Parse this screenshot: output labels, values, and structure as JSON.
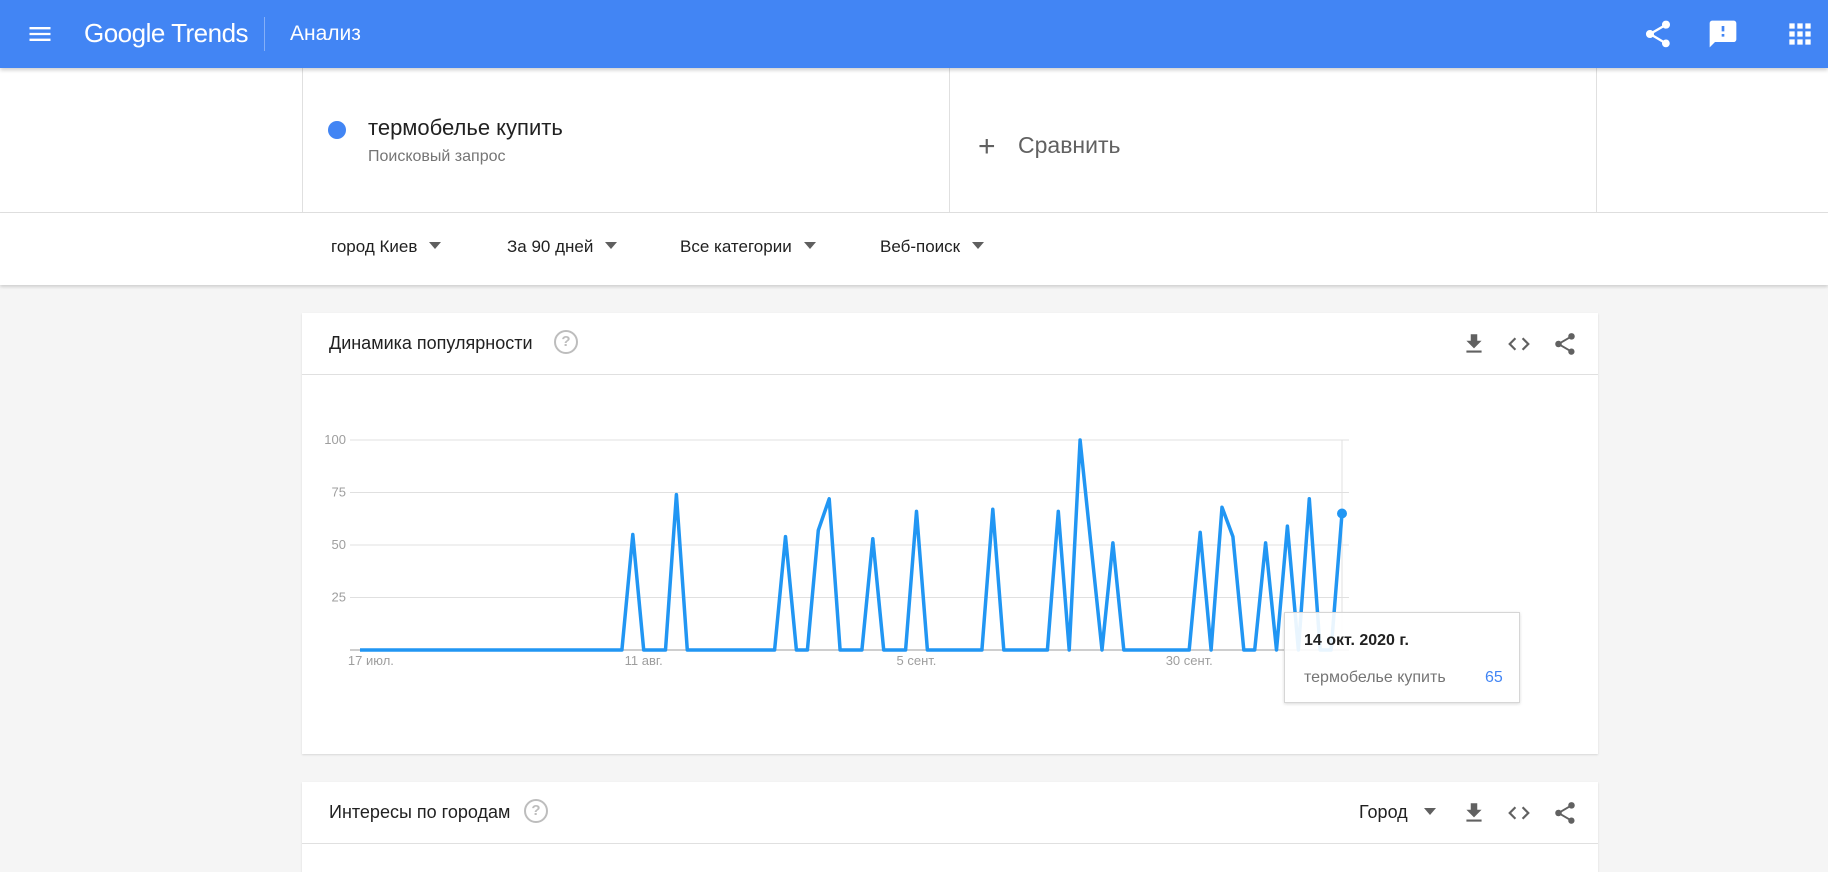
{
  "header": {
    "logo_text": "Google Trends",
    "section_title": "Анализ",
    "icons": [
      "menu-icon",
      "share-icon",
      "feedback-icon",
      "apps-icon"
    ]
  },
  "query": {
    "term": "термобелье купить",
    "term_type": "Поисковый запрос",
    "term_color": "#4285f4",
    "compare_label": "Сравнить"
  },
  "filters": {
    "region": "город Киев",
    "period": "За 90 дней",
    "category": "Все категории",
    "search_type": "Веб-поиск"
  },
  "interest_over_time": {
    "title": "Динамика популярности",
    "help_symbol": "?",
    "tooltip": {
      "date": "14 окт. 2020 г.",
      "term": "термобелье купить",
      "value": "65"
    }
  },
  "interest_by_region": {
    "title": "Интересы по городам",
    "help_symbol": "?",
    "resolution_label": "Город"
  },
  "chart_data": {
    "type": "line",
    "series": [
      {
        "name": "термобелье купить",
        "color": "#2196f3",
        "values": [
          0,
          0,
          0,
          0,
          0,
          0,
          0,
          0,
          0,
          0,
          0,
          0,
          0,
          0,
          0,
          0,
          0,
          0,
          0,
          0,
          0,
          0,
          0,
          0,
          0,
          55,
          0,
          0,
          0,
          74,
          0,
          0,
          0,
          0,
          0,
          0,
          0,
          0,
          0,
          54,
          0,
          0,
          57,
          72,
          0,
          0,
          0,
          53,
          0,
          0,
          0,
          66,
          0,
          0,
          0,
          0,
          0,
          0,
          67,
          0,
          0,
          0,
          0,
          0,
          66,
          0,
          100,
          50,
          0,
          51,
          0,
          0,
          0,
          0,
          0,
          0,
          0,
          56,
          0,
          68,
          54,
          0,
          0,
          51,
          0,
          59,
          0,
          72,
          0,
          0,
          65
        ]
      }
    ],
    "x_start": "2020-07-16",
    "x_end": "2020-10-14",
    "x_tick_labels": [
      "17 июл.",
      "11 авг.",
      "5 сент.",
      "30 сент."
    ],
    "y_ticks": [
      25,
      50,
      75,
      100
    ],
    "ylim": [
      0,
      100
    ],
    "grid": true,
    "highlighted_point": {
      "date": "14 окт. 2020 г.",
      "value": 65
    }
  }
}
